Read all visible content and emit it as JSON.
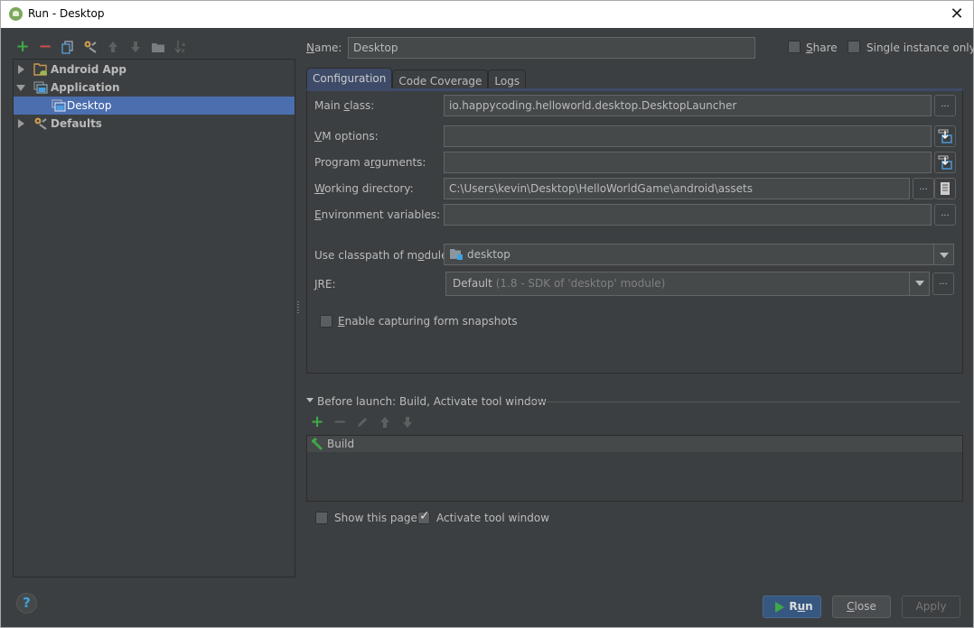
{
  "window": {
    "title": "Run - Desktop",
    "close_glyph": "✕"
  },
  "left_toolbar": {
    "icons": [
      {
        "name": "add-icon",
        "glyph": "+",
        "color": "#3fa845"
      },
      {
        "name": "remove-icon",
        "glyph": "−",
        "color": "#c94f4f"
      },
      {
        "name": "copy-icon",
        "glyph": "⧉",
        "color": "#5d9dd3"
      },
      {
        "name": "edit-defaults-icon",
        "glyph": "🔧",
        "color": "#b48f5a"
      },
      {
        "name": "move-up-icon",
        "glyph": "↑",
        "color": "#5e6060"
      },
      {
        "name": "move-down-icon",
        "glyph": "↓",
        "color": "#5e6060"
      },
      {
        "name": "folder-icon",
        "glyph": "▬",
        "color": "#7a7d80"
      },
      {
        "name": "sort-icon",
        "glyph": "↓",
        "color": "#5e6060"
      }
    ]
  },
  "tree": {
    "items": [
      {
        "label": "Android App",
        "expanded": false,
        "level": 0
      },
      {
        "label": "Application",
        "expanded": true,
        "level": 0
      },
      {
        "label": "Desktop",
        "selected": true,
        "level": 1
      },
      {
        "label": "Defaults",
        "expanded": false,
        "level": 0
      }
    ]
  },
  "header": {
    "name_label": "Name:",
    "name_value": "Desktop",
    "share_label": "Share",
    "share_checked": false,
    "single_instance_label": "Single instance only",
    "single_instance_checked": false
  },
  "tabs": [
    {
      "label": "Configuration",
      "active": true
    },
    {
      "label": "Code Coverage",
      "active": false
    },
    {
      "label": "Logs",
      "active": false
    }
  ],
  "config": {
    "main_class_label": "Main class:",
    "main_class_value": "io.happycoding.helloworld.desktop.DesktopLauncher",
    "vm_options_label": "VM options:",
    "vm_options_value": "",
    "program_args_label": "Program arguments:",
    "program_args_value": "",
    "working_dir_label": "Working directory:",
    "working_dir_value": "C:\\Users\\kevin\\Desktop\\HelloWorldGame\\android\\assets",
    "env_vars_label": "Environment variables:",
    "env_vars_value": "",
    "classpath_label": "Use classpath of module:",
    "classpath_value": "desktop",
    "jre_label": "JRE:",
    "jre_value": "Default",
    "jre_hint": "(1.8 - SDK of 'desktop' module)",
    "snapshots_label": "Enable capturing form snapshots",
    "snapshots_checked": false,
    "ellipsis": "..."
  },
  "before_launch": {
    "header": "Before launch: Build, Activate tool window",
    "tasks": [
      {
        "label": "Build"
      }
    ],
    "show_page_label": "Show this page",
    "show_page_checked": false,
    "activate_tool_label": "Activate tool window",
    "activate_tool_checked": true
  },
  "buttons": {
    "run": "Run",
    "close": "Close",
    "apply": "Apply",
    "help": "?"
  },
  "colors": {
    "background": "#3c3f41",
    "selection": "#4b6eaf",
    "accent_green": "#3fa845",
    "run_button": "#365880"
  }
}
